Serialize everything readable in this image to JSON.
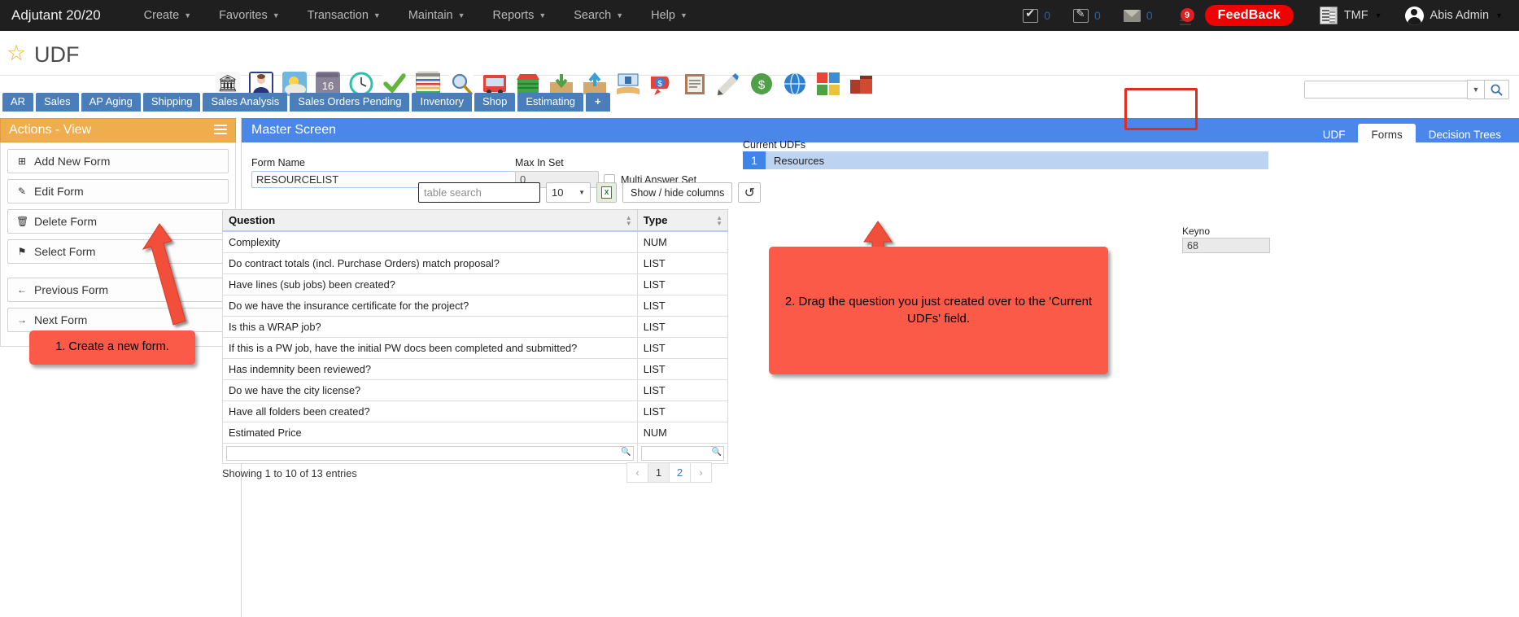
{
  "topnav": {
    "brand": "Adjutant 20/20",
    "menus": [
      {
        "label": "Create"
      },
      {
        "label": "Favorites"
      },
      {
        "label": "Transaction"
      },
      {
        "label": "Maintain"
      },
      {
        "label": "Reports"
      },
      {
        "label": "Search"
      },
      {
        "label": "Help"
      }
    ],
    "counters": [
      {
        "icon": "checkbox-icon",
        "count": "0"
      },
      {
        "icon": "edit-note-icon",
        "count": "0"
      },
      {
        "icon": "envelope-icon",
        "count": "0"
      }
    ],
    "server_badge": "9",
    "feedback_label": "FeedBack",
    "company": "TMF",
    "user": "Abis Admin"
  },
  "page": {
    "title": "UDF",
    "star_icon": "star-icon"
  },
  "toolbar_icons": [
    {
      "name": "bank-icon",
      "glyph": "🏛"
    },
    {
      "name": "contact-person-icon",
      "glyph": "👤"
    },
    {
      "name": "weather-icon",
      "glyph": "🌤"
    },
    {
      "name": "calendar-16-icon",
      "glyph": "16"
    },
    {
      "name": "clock-icon",
      "glyph": "🕐"
    },
    {
      "name": "checkmark-icon",
      "glyph": "✔"
    },
    {
      "name": "spreadsheet-icon",
      "glyph": "☰"
    },
    {
      "name": "magnifier-icon",
      "glyph": "🔍"
    },
    {
      "name": "truck-icon",
      "glyph": "🚚"
    },
    {
      "name": "storefront-icon",
      "glyph": "🏪"
    },
    {
      "name": "inbox-download-icon",
      "glyph": "⬇"
    },
    {
      "name": "outbox-upload-icon",
      "glyph": "⬆"
    },
    {
      "name": "money-hands-icon",
      "glyph": "💵"
    },
    {
      "name": "price-tag-dollar-icon",
      "glyph": "$"
    },
    {
      "name": "clipboard-notes-icon",
      "glyph": "📋"
    },
    {
      "name": "pencil-ruler-icon",
      "glyph": "✏"
    },
    {
      "name": "dollar-badge-icon",
      "glyph": "💲"
    },
    {
      "name": "globe-icon",
      "glyph": "🌐"
    },
    {
      "name": "colorful-squares-icon",
      "glyph": "◰"
    },
    {
      "name": "boxes-icon",
      "glyph": "📦"
    }
  ],
  "search": {
    "value": "",
    "placeholder": "",
    "dropdown_icon": "chevron-down-icon",
    "search_icon": "search-icon"
  },
  "tabs": [
    {
      "label": "AR"
    },
    {
      "label": "Sales"
    },
    {
      "label": "AP Aging"
    },
    {
      "label": "Shipping"
    },
    {
      "label": "Sales Analysis"
    },
    {
      "label": "Sales Orders Pending"
    },
    {
      "label": "Inventory"
    },
    {
      "label": "Shop"
    },
    {
      "label": "Estimating"
    },
    {
      "label": "+"
    }
  ],
  "actions": {
    "title": "Actions - View",
    "menu_icon": "hamburger-icon",
    "buttons": [
      {
        "label": "Add New Form",
        "icon": "plus-square-icon",
        "glyph": "⊞"
      },
      {
        "label": "Edit Form",
        "icon": "pencil-icon",
        "glyph": "✎"
      },
      {
        "label": "Delete Form",
        "icon": "trash-icon",
        "glyph": "🗑"
      },
      {
        "label": "Select Form",
        "icon": "pin-icon",
        "glyph": "⚑"
      }
    ],
    "nav_buttons": [
      {
        "label": "Previous Form",
        "icon": "arrow-left-icon",
        "glyph": "←"
      },
      {
        "label": "Next Form",
        "icon": "arrow-right-icon",
        "glyph": "→"
      }
    ]
  },
  "master": {
    "header": "Master Screen",
    "tabs": [
      {
        "label": "UDF",
        "active": false
      },
      {
        "label": "Forms",
        "active": true
      },
      {
        "label": "Decision Trees",
        "active": false
      }
    ],
    "form_name_label": "Form Name",
    "form_name_value": "RESOURCELIST",
    "max_in_set_label": "Max In Set",
    "max_in_set_value": "0",
    "multi_answer_label": "Multi Answer Set",
    "multi_answer_checked": false
  },
  "table_controls": {
    "search_placeholder": "table search",
    "search_value": "",
    "page_length": "10",
    "export_icon": "excel-export-icon",
    "show_hide_label": "Show / hide columns",
    "reset_icon": "reset-icon",
    "reset_glyph": "↺"
  },
  "table": {
    "columns": [
      "Question",
      "Type"
    ],
    "rows": [
      {
        "question": "Complexity",
        "type": "NUM"
      },
      {
        "question": "Do contract totals (incl. Purchase Orders) match proposal?",
        "type": "LIST"
      },
      {
        "question": "Have lines (sub jobs) been created?",
        "type": "LIST"
      },
      {
        "question": "Do we have the insurance certificate for the project?",
        "type": "LIST"
      },
      {
        "question": "Is this a WRAP job?",
        "type": "LIST"
      },
      {
        "question": "If this is a PW job, have the initial PW docs been completed and submitted?",
        "type": "LIST"
      },
      {
        "question": "Has indemnity been reviewed?",
        "type": "LIST"
      },
      {
        "question": "Do we have the city license?",
        "type": "LIST"
      },
      {
        "question": "Have all folders been created?",
        "type": "LIST"
      },
      {
        "question": "Estimated Price",
        "type": "NUM"
      }
    ],
    "filter_question": "",
    "filter_type": "",
    "showing": "Showing 1 to 10 of 13 entries",
    "pager": {
      "prev": "‹",
      "pages": [
        "1",
        "2"
      ],
      "current": "1",
      "next": "›"
    }
  },
  "right_panel": {
    "current_udfs_label": "Current UDFs",
    "udfs": [
      {
        "num": "1",
        "name": "Resources"
      }
    ],
    "keyno_label": "Keyno",
    "keyno_value": "68"
  },
  "annotations": [
    {
      "id": "1",
      "text": "1. Create a new form."
    },
    {
      "id": "2",
      "text": "2. Drag the question you just created over to the 'Current UDFs' field."
    }
  ],
  "colors": {
    "nav_bg": "#1f1f1f",
    "accent_blue": "#4a87e8",
    "tab_blue": "#4a7ebb",
    "actions_orange": "#f0ad4e",
    "annotation_red": "#fa5a47",
    "highlight_box": "#e32b1e",
    "feedback_red": "#f00000",
    "udf_row": "#bcd4f2"
  }
}
